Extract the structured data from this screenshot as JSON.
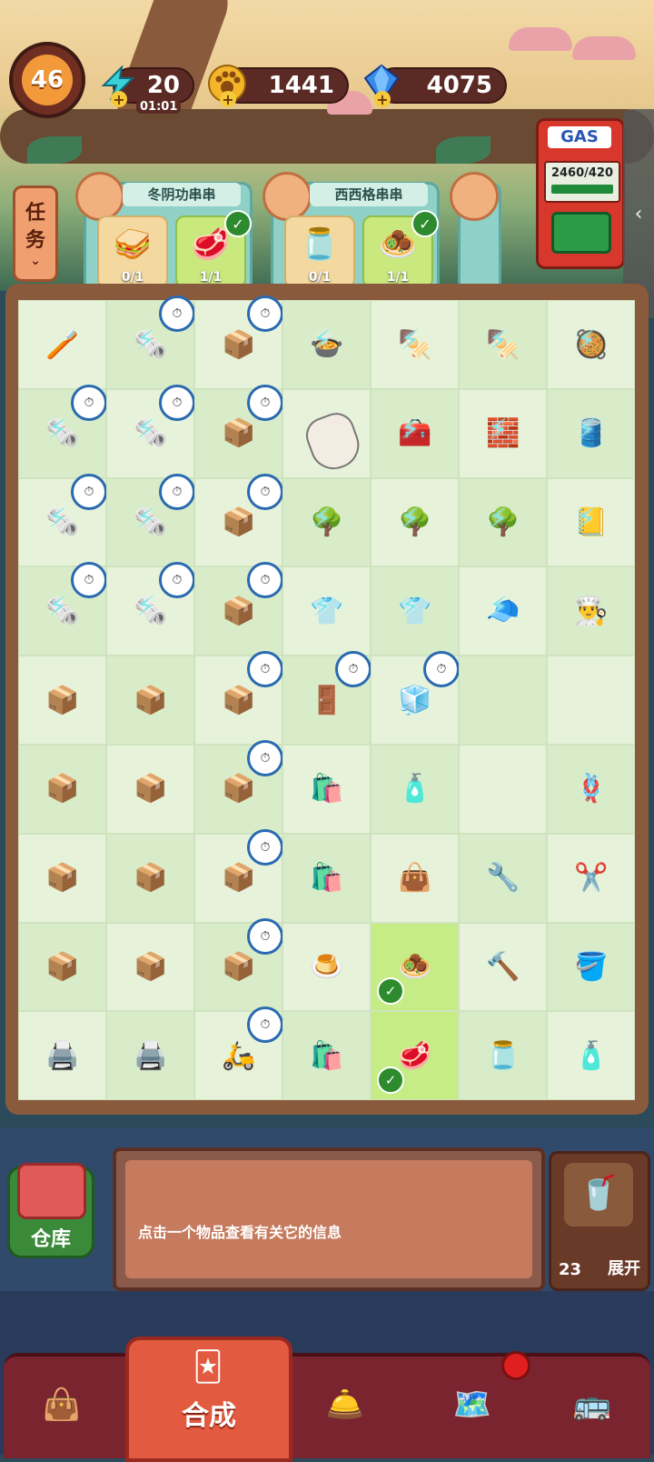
{
  "hud": {
    "level": "46",
    "energy": "20",
    "energy_timer": "01:01",
    "coins": "1441",
    "gems": "4075"
  },
  "gas": {
    "label": "GAS",
    "value": "2460/420"
  },
  "tasks": {
    "button_label_1": "任",
    "button_label_2": "务",
    "orders": [
      {
        "title": "冬阴功串串",
        "req1_count": "0/1",
        "req2_count": "1/1"
      },
      {
        "title": "西西格串串",
        "req1_count": "0/1",
        "req2_count": "1/1"
      }
    ]
  },
  "board": {
    "cells": [
      {
        "icon": "🪥",
        "clock": false,
        "bolt": false
      },
      {
        "icon": "🗞️",
        "clock": true,
        "bolt": true
      },
      {
        "icon": "📦",
        "clock": true,
        "bolt": false
      },
      {
        "icon": "🍲",
        "clock": false,
        "bolt": true
      },
      {
        "icon": "🍢",
        "clock": false,
        "bolt": true
      },
      {
        "icon": "🍢",
        "clock": false,
        "bolt": true
      },
      {
        "icon": "🥘",
        "clock": false,
        "bolt": true
      },
      {
        "icon": "🗞️",
        "clock": true,
        "bolt": true
      },
      {
        "icon": "🗞️",
        "clock": true,
        "bolt": true
      },
      {
        "icon": "📦",
        "clock": true,
        "bolt": false
      },
      {
        "icon": "🧊",
        "clock": false,
        "bolt": false
      },
      {
        "icon": "🧰",
        "clock": false,
        "bolt": true
      },
      {
        "icon": "🧱",
        "clock": false,
        "bolt": true
      },
      {
        "icon": "🛢️",
        "clock": false,
        "bolt": true
      },
      {
        "icon": "🗞️",
        "clock": true,
        "bolt": true
      },
      {
        "icon": "🗞️",
        "clock": true,
        "bolt": true
      },
      {
        "icon": "📦",
        "clock": true,
        "bolt": false
      },
      {
        "icon": "🌳",
        "clock": false,
        "bolt": true
      },
      {
        "icon": "🌳",
        "clock": false,
        "bolt": true
      },
      {
        "icon": "🌳",
        "clock": false,
        "bolt": true
      },
      {
        "icon": "📒",
        "clock": false,
        "bolt": true
      },
      {
        "icon": "🗞️",
        "clock": true,
        "bolt": true
      },
      {
        "icon": "🗞️",
        "clock": true,
        "bolt": true
      },
      {
        "icon": "📦",
        "clock": true,
        "bolt": false
      },
      {
        "icon": "👕",
        "clock": false,
        "bolt": true
      },
      {
        "icon": "👕",
        "clock": false,
        "bolt": true
      },
      {
        "icon": "🧢",
        "clock": false,
        "bolt": true
      },
      {
        "icon": "👨‍🍳",
        "clock": false,
        "bolt": false
      },
      {
        "icon": "📦",
        "clock": false,
        "bolt": false
      },
      {
        "icon": "📦",
        "clock": false,
        "bolt": false
      },
      {
        "icon": "📦",
        "clock": true,
        "bolt": false
      },
      {
        "icon": "🚪",
        "clock": true,
        "bolt": false
      },
      {
        "icon": "🧊",
        "clock": true,
        "bolt": false
      },
      {
        "icon": "",
        "clock": false,
        "bolt": false
      },
      {
        "icon": "",
        "clock": false,
        "bolt": false
      },
      {
        "icon": "📦",
        "clock": false,
        "bolt": false
      },
      {
        "icon": "📦",
        "clock": false,
        "bolt": false
      },
      {
        "icon": "📦",
        "clock": true,
        "bolt": false
      },
      {
        "icon": "🛍️",
        "clock": false,
        "bolt": false
      },
      {
        "icon": "🧴",
        "clock": false,
        "bolt": false
      },
      {
        "icon": "",
        "clock": false,
        "bolt": false
      },
      {
        "icon": "🪢",
        "clock": false,
        "bolt": false
      },
      {
        "icon": "📦",
        "clock": false,
        "bolt": false
      },
      {
        "icon": "📦",
        "clock": false,
        "bolt": false
      },
      {
        "icon": "📦",
        "clock": true,
        "bolt": false
      },
      {
        "icon": "🛍️",
        "clock": false,
        "bolt": false
      },
      {
        "icon": "👜",
        "clock": false,
        "bolt": false
      },
      {
        "icon": "🔧",
        "clock": false,
        "bolt": false
      },
      {
        "icon": "✂️",
        "clock": false,
        "bolt": false
      },
      {
        "icon": "📦",
        "clock": false,
        "bolt": false
      },
      {
        "icon": "📦",
        "clock": false,
        "bolt": false
      },
      {
        "icon": "📦",
        "clock": true,
        "bolt": false
      },
      {
        "icon": "🍮",
        "clock": false,
        "bolt": false
      },
      {
        "icon": "🧆",
        "clock": false,
        "bolt": false,
        "check": true,
        "highlight": true
      },
      {
        "icon": "🔨",
        "clock": false,
        "bolt": false
      },
      {
        "icon": "🪣",
        "clock": false,
        "bolt": false
      },
      {
        "icon": "🖨️",
        "clock": false,
        "bolt": false
      },
      {
        "icon": "🖨️",
        "clock": false,
        "bolt": false
      },
      {
        "icon": "🛵",
        "clock": true,
        "bolt": false
      },
      {
        "icon": "🛍️",
        "clock": false,
        "bolt": false
      },
      {
        "icon": "🥩",
        "clock": false,
        "bolt": false,
        "check": true,
        "highlight": true
      },
      {
        "icon": "🫙",
        "clock": false,
        "bolt": false
      },
      {
        "icon": "🧴",
        "clock": false,
        "bolt": false
      }
    ]
  },
  "info": {
    "storage_label": "仓库",
    "hint": "点击一个物品查看有关它的信息",
    "bag_count": "23",
    "expand_label": "展开"
  },
  "nav": {
    "active_label": "合成",
    "icons": [
      "shop-bag-icon",
      "craft-icon",
      "cloche-icon",
      "map-icon",
      "bus-icon"
    ]
  }
}
